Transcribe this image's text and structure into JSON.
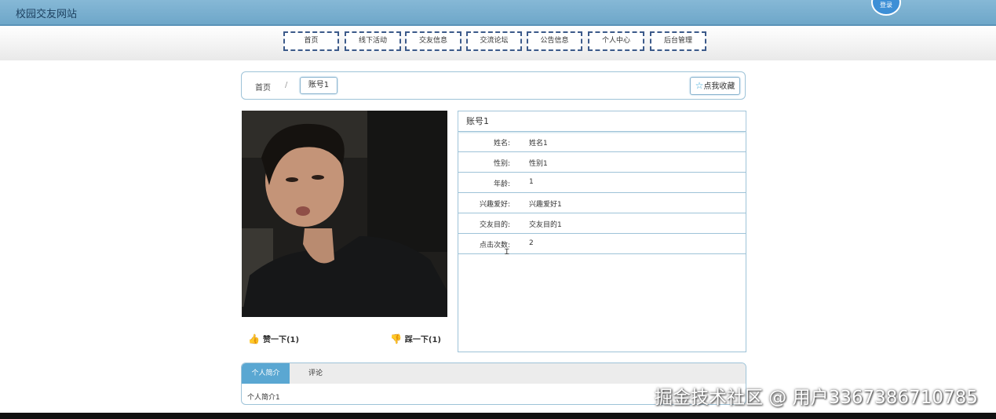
{
  "header": {
    "site_title": "校园交友网站",
    "login_badge": "登录"
  },
  "nav": {
    "items": [
      {
        "label": "首页"
      },
      {
        "label": "线下活动"
      },
      {
        "label": "交友信息"
      },
      {
        "label": "交流论坛"
      },
      {
        "label": "公告信息"
      },
      {
        "label": "个人中心"
      },
      {
        "label": "后台管理"
      }
    ]
  },
  "breadcrumb": {
    "home": "首页",
    "separator": "/",
    "current": "账号1",
    "favorite_label": "点我收藏",
    "favorite_icon": "star-icon"
  },
  "profile": {
    "title": "账号1",
    "fields": [
      {
        "label": "姓名:",
        "value": "姓名1"
      },
      {
        "label": "性别:",
        "value": "性别1"
      },
      {
        "label": "年龄:",
        "value": "1"
      },
      {
        "label": "兴趣爱好:",
        "value": "兴趣爱好1"
      },
      {
        "label": "交友目的:",
        "value": "交友目的1"
      },
      {
        "label": "点击次数:",
        "value": "2"
      }
    ]
  },
  "actions": {
    "like_label": "赞一下(1)",
    "dislike_label": "踩一下(1)"
  },
  "tabs": {
    "items": [
      {
        "label": "个人简介"
      },
      {
        "label": "评论"
      }
    ],
    "content": "个人简介1"
  },
  "watermark": "掘金技术社区 @ 用户3367386710785",
  "colors": {
    "topbar": "#6ea7c9",
    "accent": "#5aa7d2",
    "nav_border": "#3c5a8a",
    "thumb": "#d23a2b"
  }
}
